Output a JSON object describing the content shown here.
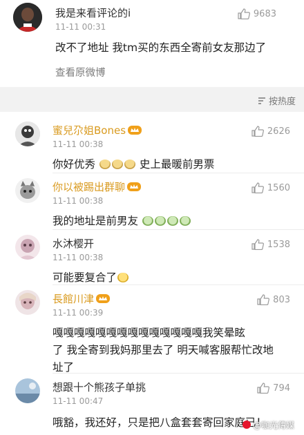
{
  "post": {
    "username": "我是来看评论的i",
    "time": "11-11 00:31",
    "likes": "9683",
    "text": "改不了地址 我tm买的东西全寄前女友那边了",
    "view_original": "查看原微博"
  },
  "sort": {
    "label": "按热度",
    "icon": "sort-icon"
  },
  "comments": [
    {
      "username": "蜜兒尕姐Bones",
      "badge": "vip-crown-icon",
      "time": "11-11 00:38",
      "likes": "2626",
      "text_a": "你好优秀",
      "emoji_a": "doge-emoji",
      "text_b": "史上最暖前男票"
    },
    {
      "username": "你以被踢出群聊",
      "badge": "vip-crown-icon",
      "time": "11-11 00:38",
      "likes": "1560",
      "text_a": "我的地址是前男友",
      "emoji_a": "cry-emoji"
    },
    {
      "username": "水沐樱开",
      "time": "11-11 00:38",
      "likes": "1538",
      "text_a": "可能要复合了",
      "emoji_a": "sly-emoji"
    },
    {
      "username": "長館川津",
      "badge": "vip-crown-icon",
      "time": "11-11 00:39",
      "likes": "803",
      "line1": "嘎嘎嘎嘎嘎嘎嘎嘎嘎嘎嘎嘎嘎嘎我笑晕眩",
      "line2": "了 我全寄到我妈那里去了 明天喊客服帮忙改地",
      "line3": "址了"
    },
    {
      "username": "想跟十个熊孩子单挑",
      "time": "11-11 00:47",
      "likes": "794",
      "text_a": "哦豁，我还好，只是把八盒套套寄回家庭已！"
    }
  ],
  "watermark": "@咖光傳媒",
  "colors": {
    "gold_name": "#d99a1e",
    "like_gray": "#9a9a9a",
    "bg": "#f2f2f2"
  }
}
